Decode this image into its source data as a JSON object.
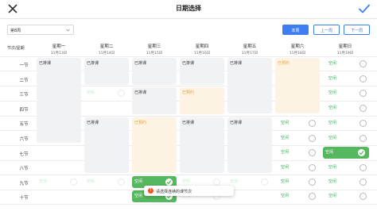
{
  "header": {
    "title": "日期选择",
    "close_icon": "close-icon",
    "confirm_icon": "check-icon"
  },
  "controls": {
    "week_select": "第8周",
    "this_week": "本周",
    "prev_week": "上一周",
    "next_week": "下一周"
  },
  "corner_label": "节次/星期",
  "days": [
    {
      "name": "星期一",
      "date": "11月13日"
    },
    {
      "name": "星期二",
      "date": "11月14日"
    },
    {
      "name": "星期三",
      "date": "11月15日"
    },
    {
      "name": "星期四",
      "date": "11月16日"
    },
    {
      "name": "星期五",
      "date": "11月17日"
    },
    {
      "name": "星期六",
      "date": "11月18日"
    },
    {
      "name": "星期日",
      "date": "11月19日"
    }
  ],
  "periods": [
    "一节",
    "二节",
    "三节",
    "四节",
    "五节",
    "六节",
    "七节",
    "八节",
    "九节",
    "十节"
  ],
  "status": {
    "occupied": "已排课",
    "reserved": "已预约",
    "free": "空闲"
  },
  "colors": {
    "accent": "#3f7ef0",
    "free": "#3dab57",
    "selected": "#55b85f",
    "reserved": "#e4a032",
    "occupied_bg": "#f1f2f4",
    "warning": "#f25022"
  },
  "toast": {
    "text": "请选择连续的课节次",
    "icon": "warning-icon"
  }
}
